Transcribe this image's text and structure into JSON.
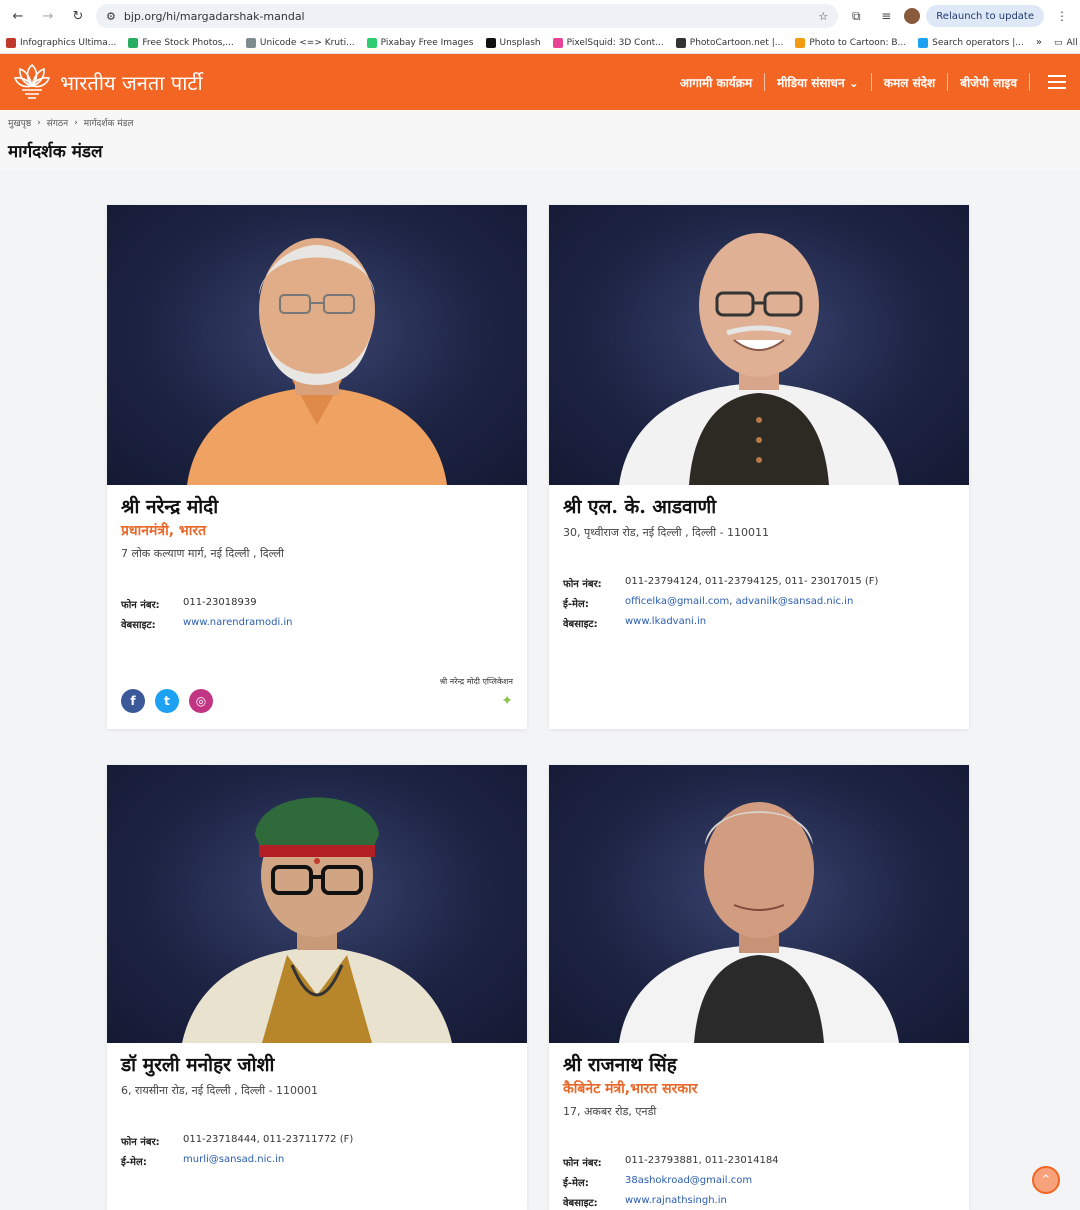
{
  "browser": {
    "url": "bjp.org/hi/margadarshak-mandal",
    "relaunch_label": "Relaunch to update",
    "bookmarks": [
      {
        "label": "Infographics Ultima...",
        "color": "#c0392b"
      },
      {
        "label": "Free Stock Photos,...",
        "color": "#27ae60"
      },
      {
        "label": "Unicode <=> Kruti...",
        "color": "#7f8c8d"
      },
      {
        "label": "Pixabay Free Images",
        "color": "#2ecc71"
      },
      {
        "label": "Unsplash",
        "color": "#111111"
      },
      {
        "label": "PixelSquid: 3D Cont...",
        "color": "#e84393"
      },
      {
        "label": "PhotoCartoon.net |...",
        "color": "#333333"
      },
      {
        "label": "Photo to Cartoon: B...",
        "color": "#f39c12"
      },
      {
        "label": "Search operators |...",
        "color": "#1da1f2"
      }
    ],
    "all_bookmarks_label": "All Bookmarks"
  },
  "site": {
    "logo_text": "भारतीय जनता पार्टी",
    "nav": [
      "आगामी कार्यक्रम",
      "मीडिया संसाधन",
      "कमल संदेश",
      "बीजेपी लाइव"
    ],
    "accent": "#f26522"
  },
  "breadcrumb": [
    "मुखपृष्ठ",
    "संगठन",
    "मार्गदर्शक मंडल"
  ],
  "page_title": "मार्गदर्शक मंडल",
  "labels": {
    "phone": "फोन नंबर:",
    "email": "ई-मेल:",
    "website": "वेबसाइट:"
  },
  "members": [
    {
      "name": "श्री नरेन्द्र मोदी",
      "role": "प्रधानमंत्री, भारत",
      "address": "7 लोक कल्याण मार्ग, नई दिल्ली , दिल्ली",
      "phone": "011-23018939",
      "email": "",
      "website": "www.narendramodi.in",
      "app_label": "श्री नरेन्द्र मोदी एप्लिकेशन"
    },
    {
      "name": "श्री एल. के. आडवाणी",
      "role": "",
      "address": "30, पृथ्वीराज रोड, नई दिल्ली , दिल्ली - 110011",
      "phone": "011-23794124, 011-23794125, 011- 23017015 (F)",
      "email_parts": [
        "officelka@gmail.com",
        "advanilk@sansad.nic.in"
      ],
      "website": "www.lkadvani.in"
    },
    {
      "name": "डॉ मुरली मनोहर जोशी",
      "role": "",
      "address": "6, रायसीना रोड, नई दिल्ली , दिल्ली - 110001",
      "phone": "011-23718444, 011-23711772 (F)",
      "email": "murli@sansad.nic.in",
      "website": ""
    },
    {
      "name": "श्री राजनाथ सिंह",
      "role": "कैबिनेट मंत्री,भारत सरकार",
      "address": "17, अकबर रोड, एनडी",
      "phone": "011-23793881, 011-23014184",
      "email": "38ashokroad@gmail.com",
      "website": "www.rajnathsingh.in"
    }
  ]
}
